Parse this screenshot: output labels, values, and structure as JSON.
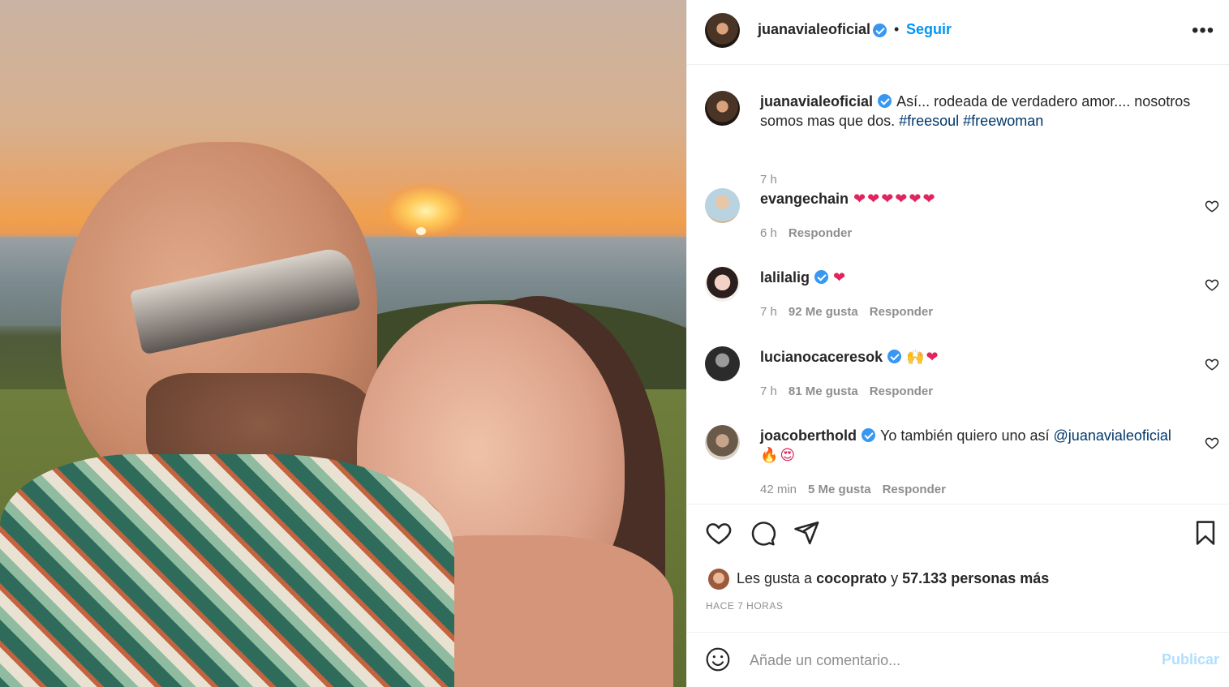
{
  "post": {
    "photo_alt": "",
    "author": "juanavialeoficial",
    "follow_label": "Seguir",
    "separator": "•",
    "more_label": "•••"
  },
  "caption": {
    "author": "juanavialeoficial",
    "text": "Así... rodeada de verdadero amor.... nosotros somos mas que dos.",
    "hashtags": [
      "#freesoul",
      "#freewoman"
    ],
    "time": "7 h"
  },
  "comments": [
    {
      "user": "evangechain",
      "verified": false,
      "text": "❤❤❤❤❤❤",
      "time": "6 h",
      "likes": "",
      "reply": "Responder"
    },
    {
      "user": "lalilalig",
      "verified": true,
      "text": "❤",
      "time": "7 h",
      "likes": "92 Me gusta",
      "reply": "Responder"
    },
    {
      "user": "lucianocaceresok",
      "verified": true,
      "text": "🙌❤",
      "time": "7 h",
      "likes": "81 Me gusta",
      "reply": "Responder"
    },
    {
      "user": "joacoberthold",
      "verified": true,
      "text": "Yo también quiero uno así",
      "mention": "@juanavialeoficial",
      "text2": "🔥😍",
      "time": "42 min",
      "likes": "5 Me gusta",
      "reply": "Responder"
    }
  ],
  "likes_summary": {
    "prefix": "Les gusta a",
    "user": "cocoprato",
    "joiner": "y",
    "others": "57.133 personas más"
  },
  "timestamp": "HACE 7 HORAS",
  "add_comment": {
    "placeholder": "Añade un comentario...",
    "post_label": "Publicar"
  },
  "icons": {
    "like": "heart-icon",
    "comment": "comment-icon",
    "share": "share-icon",
    "save": "bookmark-icon",
    "emoji": "smiley-icon"
  },
  "colors": {
    "link": "#0095f6",
    "verified": "#3897f0",
    "muted": "#8e8e8e",
    "hashtag": "#00376b"
  }
}
